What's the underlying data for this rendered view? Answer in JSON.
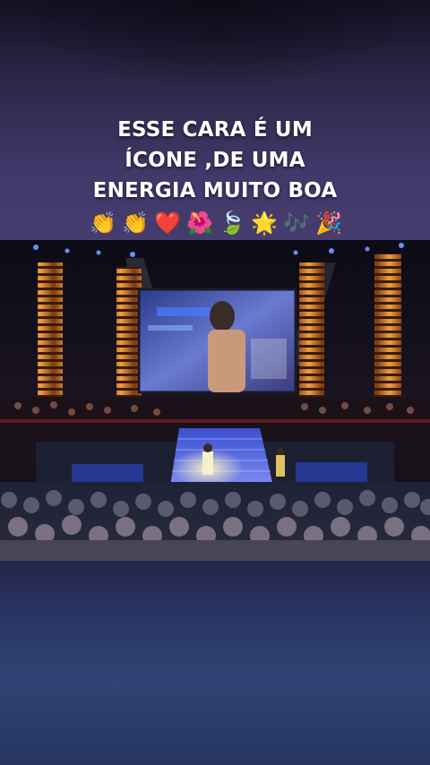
{
  "caption": {
    "line1": "ESSE CARA É UM",
    "line2": "ÍCONE ,DE UMA",
    "line3": "ENERGIA MUITO BOA"
  },
  "emojis": [
    "👏",
    "👏",
    "❤️",
    "🌺",
    "🍃",
    "🌟",
    "🎶",
    "🎉"
  ]
}
